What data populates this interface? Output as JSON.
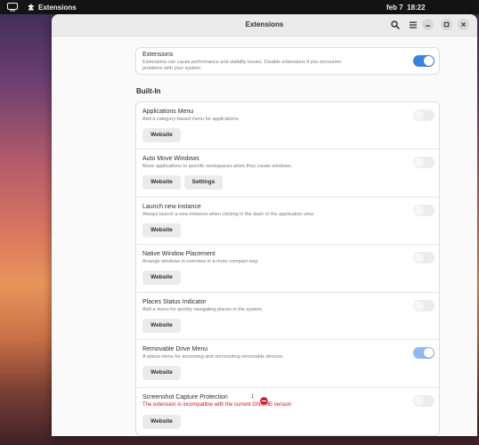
{
  "topbar": {
    "app_name": "Extensions",
    "clock": "feb 7  18:22"
  },
  "window": {
    "title": "Extensions"
  },
  "header_icons": [
    "search-icon",
    "menu-icon",
    "minimize-icon",
    "maximize-icon",
    "close-icon"
  ],
  "global": {
    "title": "Extensions",
    "description_line1": "Extensions can cause performance and stability issues. Disable extensions if you encounter",
    "description_line2": "problems with your system.",
    "enabled": true
  },
  "section_title": "Built-In",
  "extensions": [
    {
      "name": "Applications Menu",
      "description": "Add a category-based menu for applications.",
      "enabled": false,
      "buttons": [
        "Website"
      ]
    },
    {
      "name": "Auto Move Windows",
      "description": "Move applications to specific workspaces when they create windows.",
      "enabled": false,
      "buttons": [
        "Website",
        "Settings"
      ]
    },
    {
      "name": "Launch new instance",
      "description": "Always launch a new instance when clicking in the dash or the application view.",
      "enabled": false,
      "buttons": [
        "Website"
      ]
    },
    {
      "name": "Native Window Placement",
      "description": "Arrange windows in overview in a more compact way.",
      "enabled": false,
      "buttons": [
        "Website"
      ]
    },
    {
      "name": "Places Status Indicator",
      "description": "Add a menu for quickly navigating places in the system.",
      "enabled": false,
      "buttons": [
        "Website"
      ]
    },
    {
      "name": "Removable Drive Menu",
      "description": "A status menu for accessing and unmounting removable devices.",
      "enabled": true,
      "buttons": [
        "Website"
      ]
    },
    {
      "name": "Screenshot Capture Protection",
      "badge": "1",
      "error": "The extension is incompatible with the current GNOME version",
      "enabled": false,
      "buttons": [
        "Website"
      ]
    }
  ],
  "colors": {
    "accent": "#3584e4",
    "error": "#c01c28"
  }
}
